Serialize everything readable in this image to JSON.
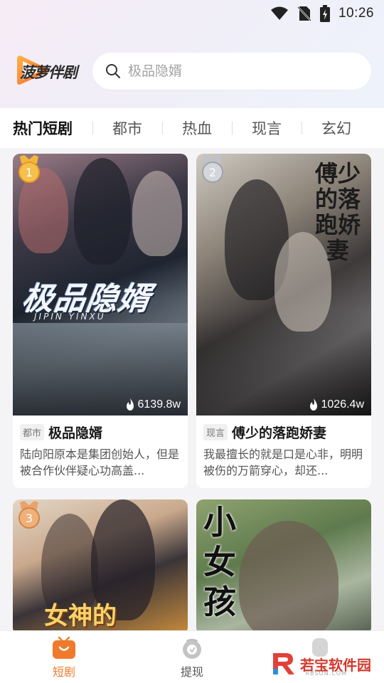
{
  "status_bar": {
    "time": "10:26"
  },
  "app": {
    "logo_text": "菠萝伴剧"
  },
  "search": {
    "placeholder": "极品隐婿"
  },
  "tabs": [
    {
      "label": "热门短剧"
    },
    {
      "label": "都市"
    },
    {
      "label": "热血"
    },
    {
      "label": "现言"
    },
    {
      "label": "玄幻"
    }
  ],
  "cards": [
    {
      "rank": "1",
      "poster_title": "极品隐婿",
      "poster_subtitle": "JIPIN YINXU",
      "views": "6139.8w",
      "genre": "都市",
      "title": "极品隐婿",
      "description": "陆向阳原本是集团创始人，但是被合作伙伴疑心功高盖..."
    },
    {
      "rank": "2",
      "poster_title": "傅少的落跑娇妻",
      "views": "1026.4w",
      "genre": "现言",
      "title": "傅少的落跑娇妻",
      "description": "我最擅长的就是口是心非，明明被伤的万箭穿心，却还..."
    },
    {
      "rank": "3",
      "poster_title": "女神的"
    },
    {
      "poster_title": "小女孩"
    }
  ],
  "bottom_nav": [
    {
      "label": "短剧",
      "icon": "tv-icon",
      "active": true
    },
    {
      "label": "提现",
      "icon": "wallet-icon",
      "active": false
    }
  ],
  "watermark": {
    "text": "若宝软件园",
    "sub": "RBSON.COM"
  },
  "colors": {
    "accent": "#f07a2c"
  }
}
